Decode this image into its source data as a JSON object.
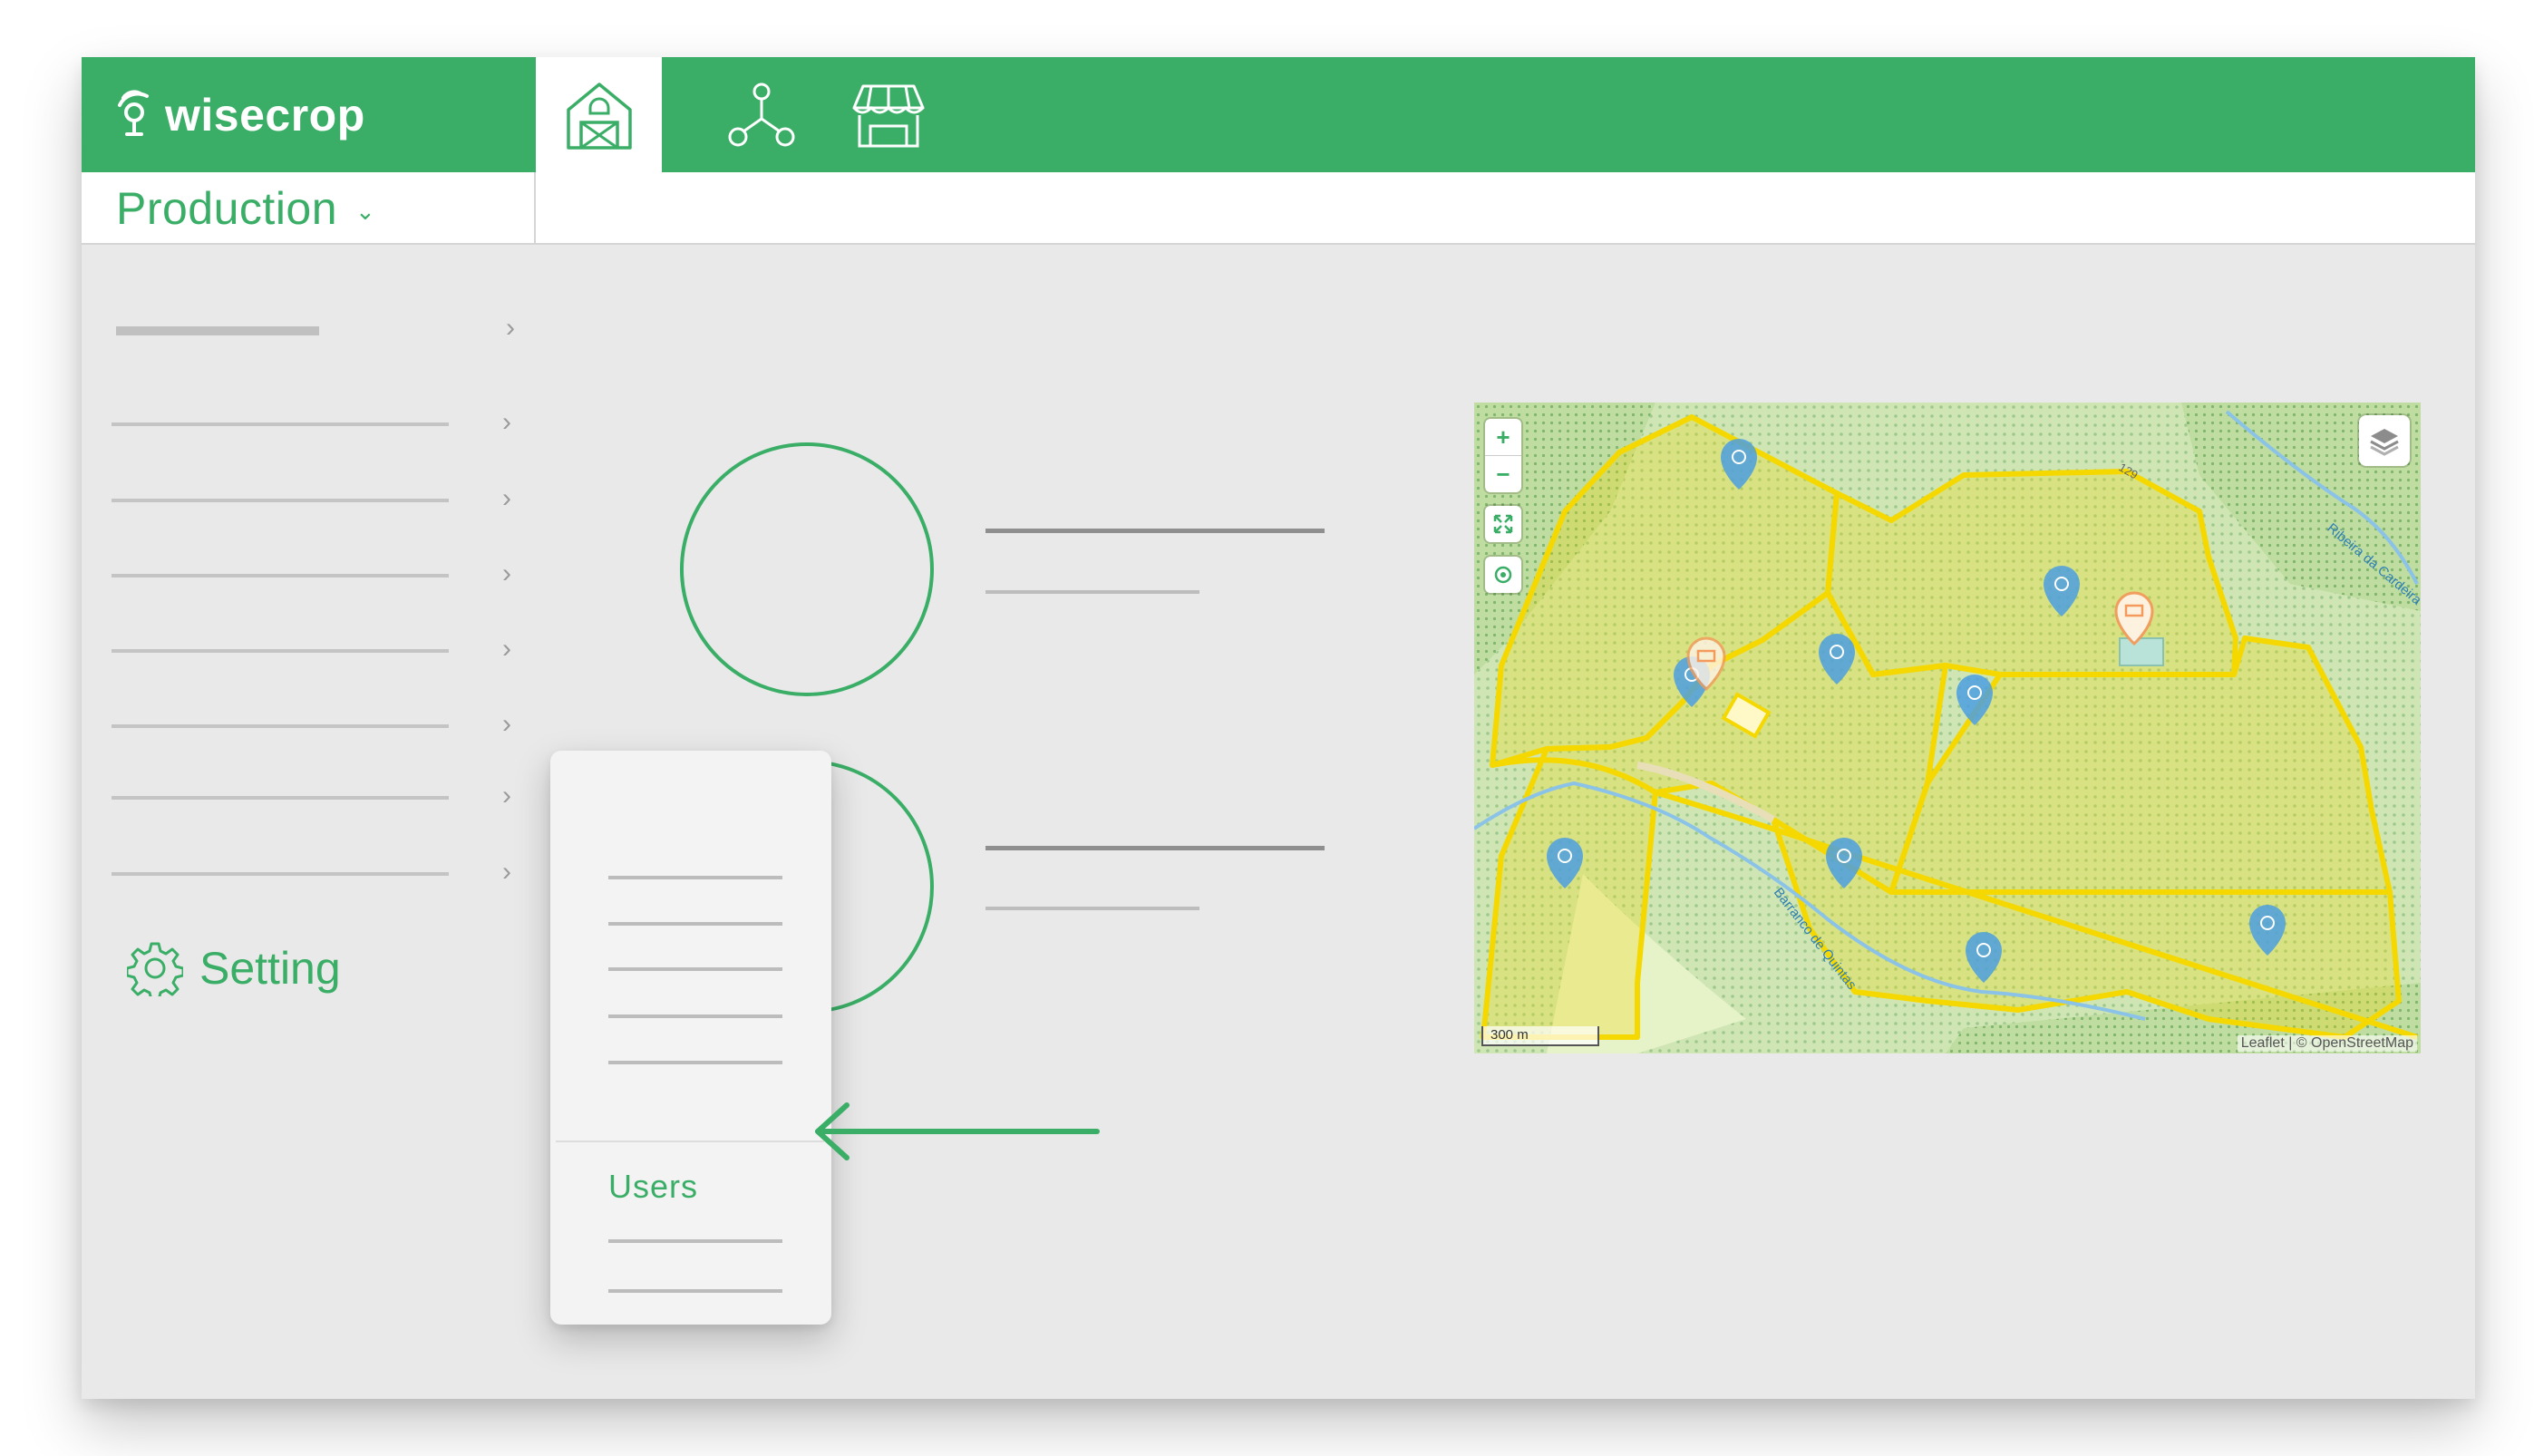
{
  "brand": {
    "name": "wisecrop",
    "color": "#3aae66"
  },
  "nav": {
    "tabs": [
      {
        "icon": "barn-icon",
        "active": true
      },
      {
        "icon": "network-icon",
        "active": false
      },
      {
        "icon": "market-stall-icon",
        "active": false
      }
    ]
  },
  "module": {
    "label": "Production",
    "chevron": "⌄"
  },
  "sidebar": {
    "setting_label": "Setting"
  },
  "dropdown": {
    "highlight_label": "Users"
  },
  "map": {
    "scale_label": "300 m",
    "attribution": "Leaflet | © OpenStreetMap",
    "zoom_in": "+",
    "zoom_out": "−",
    "labels": [
      "Barranco de Quintas",
      "Ribeira da Cardeira",
      "129"
    ]
  },
  "colors": {
    "accent": "#3aae66",
    "background": "#e9e9e9",
    "parcel": "#f5d800",
    "marker_blue": "#4b9fe0",
    "marker_orange": "#f39a5c"
  }
}
